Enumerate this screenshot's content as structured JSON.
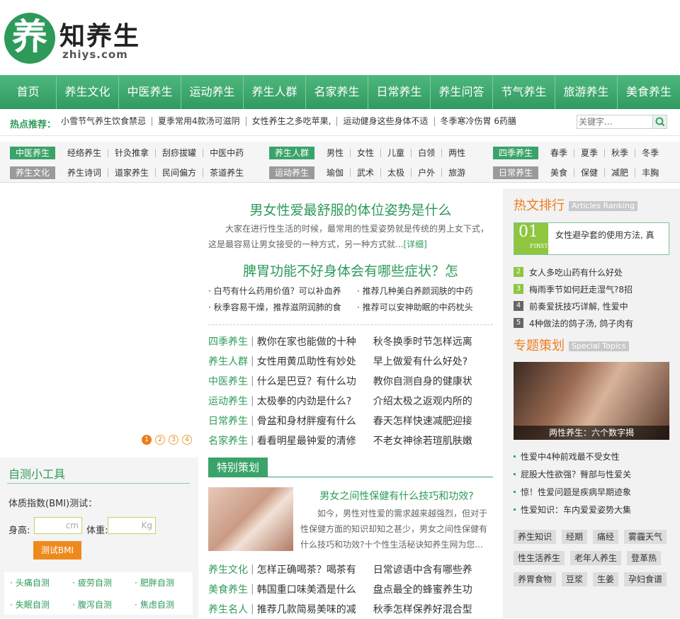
{
  "logo": {
    "char": "养",
    "name_a": "知",
    "name_b": "养生",
    "domain": "zhiys.com"
  },
  "nav": [
    "首页",
    "养生文化",
    "中医养生",
    "运动养生",
    "养生人群",
    "名家养生",
    "日常养生",
    "养生问答",
    "节气养生",
    "旅游养生",
    "美食养生"
  ],
  "hot": {
    "label": "热点推荐：",
    "items": [
      "小雪节气养生饮食禁忌",
      "夏季常用4款汤可滋阴",
      "女性养生之多吃苹果,",
      "运动健身这些身体不适",
      "冬季寒冷伤胃 6药膳"
    ],
    "search_placeholder": "关键字..."
  },
  "cats": {
    "r1": [
      {
        "tag": "中医养生",
        "items": [
          "经络养生",
          "针灸推拿",
          "刮痧拔罐",
          "中医中药"
        ]
      },
      {
        "tag": "养生人群",
        "items": [
          "男性",
          "女性",
          "儿童",
          "白领",
          "两性"
        ]
      },
      {
        "tag": "四季养生",
        "items": [
          "春季",
          "夏季",
          "秋季",
          "冬季"
        ]
      }
    ],
    "r2": [
      {
        "tag": "养生文化",
        "items": [
          "养生诗词",
          "道家养生",
          "民间偏方",
          "茶道养生"
        ]
      },
      {
        "tag": "运动养生",
        "items": [
          "瑜伽",
          "武术",
          "太极",
          "户外",
          "旅游"
        ]
      },
      {
        "tag": "日常养生",
        "items": [
          "美食",
          "保健",
          "减肥",
          "丰胸"
        ]
      }
    ]
  },
  "slider_dots": [
    "1",
    "2",
    "3",
    "4"
  ],
  "tools": {
    "title": "自测小工具",
    "bmi": "体质指数(BMI)测试：",
    "h_label": "身高:",
    "h_unit": "cm",
    "w_label": "体重:",
    "w_unit": "Kg",
    "btn": "测试BMI",
    "links": [
      "头痛自测",
      "疲劳自测",
      "肥胖自测",
      "失眠自测",
      "腹泻自测",
      "焦虑自测"
    ]
  },
  "main": {
    "h1": "男女性爱最舒服的体位姿势是什么",
    "sum1": "大家在进行性生活的时候，最常用的性爱姿势就是传统的男上女下式，这是最容易让男女接受的一种方式，另一种方式就...",
    "more": "[详细]",
    "h2": "脾胃功能不好身体会有哪些症状？怎",
    "bullets": [
      "白芍有什么药用价值？可以补血养",
      "推荐几种美白养颜润肤的中药",
      "秋季容易干燥，推荐滋阴润肺的食",
      "推荐可以安神助眠的中药枕头"
    ],
    "rows": [
      {
        "c": "四季养生",
        "t1": "教你在家也能做的十种",
        "t2": "秋冬换季时节怎样远离"
      },
      {
        "c": "养生人群",
        "t1": "女性用黄瓜助性有妙处",
        "t2": "早上做爱有什么好处?"
      },
      {
        "c": "中医养生",
        "t1": "什么是巴豆？有什么功",
        "t2": "教你自测自身的健康状"
      },
      {
        "c": "运动养生",
        "t1": "太极拳的内劲是什么?",
        "t2": "介绍太极之返观内所的"
      },
      {
        "c": "日常养生",
        "t1": "骨盆和身材胖瘦有什么",
        "t2": "春天怎样快速减肥迎接"
      },
      {
        "c": "名家养生",
        "t1": "看看明星最钟爱的清修",
        "t2": "不老女神徐若瑄肌肤嫩"
      }
    ],
    "special_tab": "特别策划",
    "s_title": "男女之间性保健有什么技巧和功效?",
    "s_desc": "如今，男性对性爱的需求越来越强烈，但对于性保健方面的知识却知之甚少，男女之间性保健有什么技巧和功效?十个性生活秘诀知养生网为您...",
    "rows2": [
      {
        "c": "养生文化",
        "t1": "怎样正确喝茶？喝茶有",
        "t2": "日常谚语中含有哪些养"
      },
      {
        "c": "美食养生",
        "t1": "韩国重口味美酒是什么",
        "t2": "盘点最全的蜂蜜养生功"
      },
      {
        "c": "养生名人",
        "t1": "推荐几款简易美味的减",
        "t2": "秋季怎样保养好混合型"
      }
    ]
  },
  "right": {
    "rank_title": "热文排行",
    "rank_en": "Articles Ranking",
    "top": {
      "num": "01",
      "sub": "FIRST",
      "text": "女性避孕套的使用方法, 真"
    },
    "list": [
      {
        "n": "2",
        "t": "女人多吃山药有什么好处"
      },
      {
        "n": "3",
        "t": "梅雨季节如何赶走湿气?8招"
      },
      {
        "n": "4",
        "t": "前奏爱抚技巧详解, 性爱中"
      },
      {
        "n": "5",
        "t": "4种做法的鸽子汤, 鸽子肉有"
      }
    ],
    "topic_title": "专题策划",
    "topic_en": "Special Topics",
    "caption": "两性养生：六个数字揭",
    "list2": [
      "性爱中4种前戏最不受女性",
      "屁股大性欲强？臀部与性爱关",
      "惊！性爱问题是疾病早期迹象",
      "性爱知识：车内爱爱姿势大集"
    ],
    "tags": [
      "养生知识",
      "经期",
      "痛经",
      "雾霾天气",
      "性生活养生",
      "老年人养生",
      "登革热",
      "养胃食物",
      "豆浆",
      "生姜",
      "孕妇食谱"
    ]
  },
  "colors": {
    "green": "#2e9a5a",
    "orange": "#ee7d1a"
  }
}
